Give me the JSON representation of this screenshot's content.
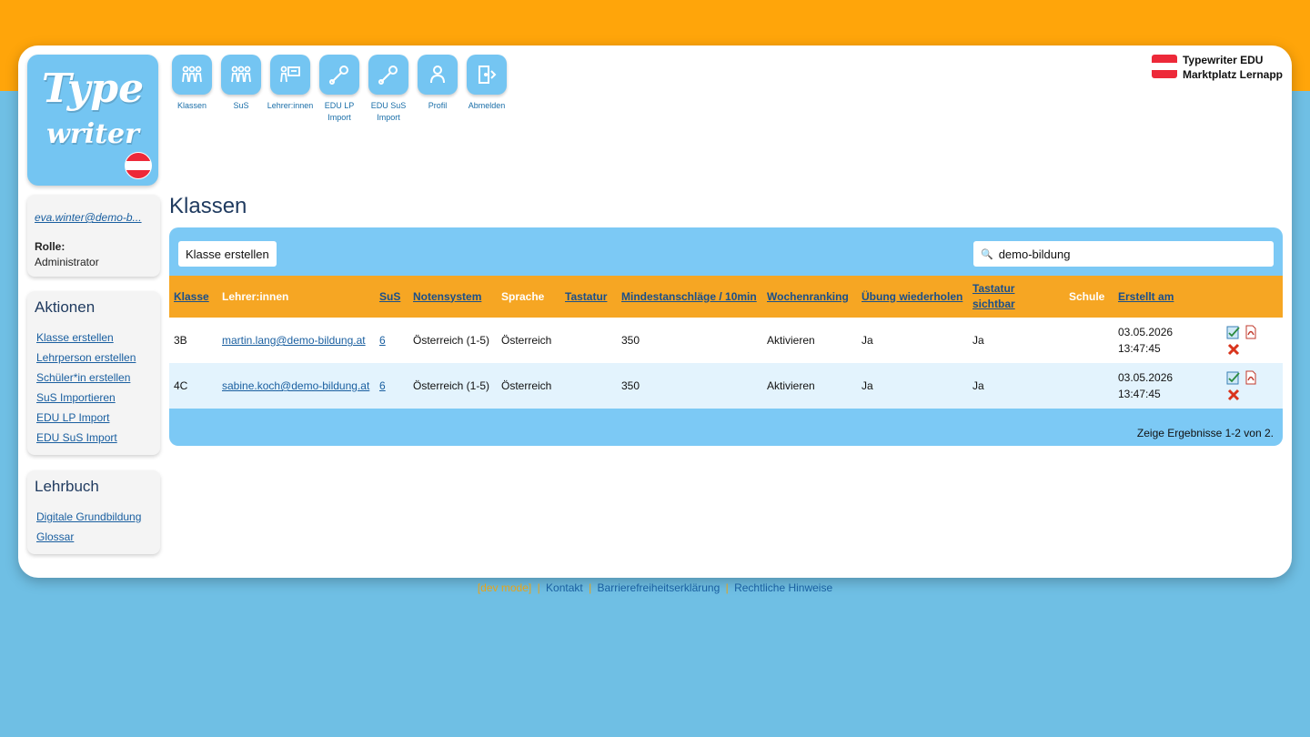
{
  "logo": {
    "line1": "Type",
    "line2": "writer"
  },
  "brand": {
    "line1": "Typewriter EDU",
    "line2": "Marktplatz Lernapp"
  },
  "nav": [
    {
      "label": "Klassen",
      "icon": "people-icon"
    },
    {
      "label": "SuS",
      "icon": "people-icon"
    },
    {
      "label": "Lehrer:innen",
      "icon": "teacher-icon"
    },
    {
      "label": "EDU LP Import",
      "icon": "wrench-icon"
    },
    {
      "label": "EDU SuS Import",
      "icon": "wrench-icon"
    },
    {
      "label": "Profil",
      "icon": "person-icon"
    },
    {
      "label": "Abmelden",
      "icon": "logout-icon"
    }
  ],
  "user": {
    "email": "eva.winter@demo-b...",
    "role_label": "Rolle:",
    "role": "Administrator"
  },
  "actions": {
    "title": "Aktionen",
    "links": [
      "Klasse erstellen",
      "Lehrperson erstellen",
      "Schüler*in erstellen",
      "SuS Importieren",
      "EDU LP Import",
      "EDU SuS Import"
    ]
  },
  "book": {
    "title": "Lehrbuch",
    "links": [
      "Digitale Grundbildung",
      "Glossar"
    ]
  },
  "page": {
    "title": "Klassen"
  },
  "toolbar": {
    "create_label": "Klasse erstellen",
    "search_value": "demo-bildung"
  },
  "table": {
    "headers": [
      "Klasse",
      "Lehrer:innen",
      "SuS",
      "Notensystem",
      "Sprache",
      "Tastatur",
      "Mindestanschläge / 10min",
      "Wochenranking",
      "Übung wiederholen",
      "Tastatur sichtbar",
      "Schule",
      "Erstellt am"
    ],
    "rows": [
      {
        "klasse": "3B",
        "lehrer": "martin.lang@demo-bildung.at",
        "sus": "6",
        "noten": "Österreich (1-5)",
        "sprache": "Österreich",
        "tastatur": "",
        "mind": "350",
        "woche": "Aktivieren",
        "uebung": "Ja",
        "sichtbar": "Ja",
        "schule": "",
        "erstellt": "03.05.2026 13:47:45"
      },
      {
        "klasse": "4C",
        "lehrer": "sabine.koch@demo-bildung.at",
        "sus": "6",
        "noten": "Österreich (1-5)",
        "sprache": "Österreich",
        "tastatur": "",
        "mind": "350",
        "woche": "Aktivieren",
        "uebung": "Ja",
        "sichtbar": "Ja",
        "schule": "",
        "erstellt": "03.05.2026 13:47:45"
      }
    ],
    "summary": "Zeige Ergebnisse 1-2 von 2."
  },
  "footer": {
    "dev": "[dev mode]",
    "links": [
      "Kontakt",
      "Barrierefreiheitserklärung",
      "Rechtliche Hinweise"
    ],
    "separator": "|"
  }
}
